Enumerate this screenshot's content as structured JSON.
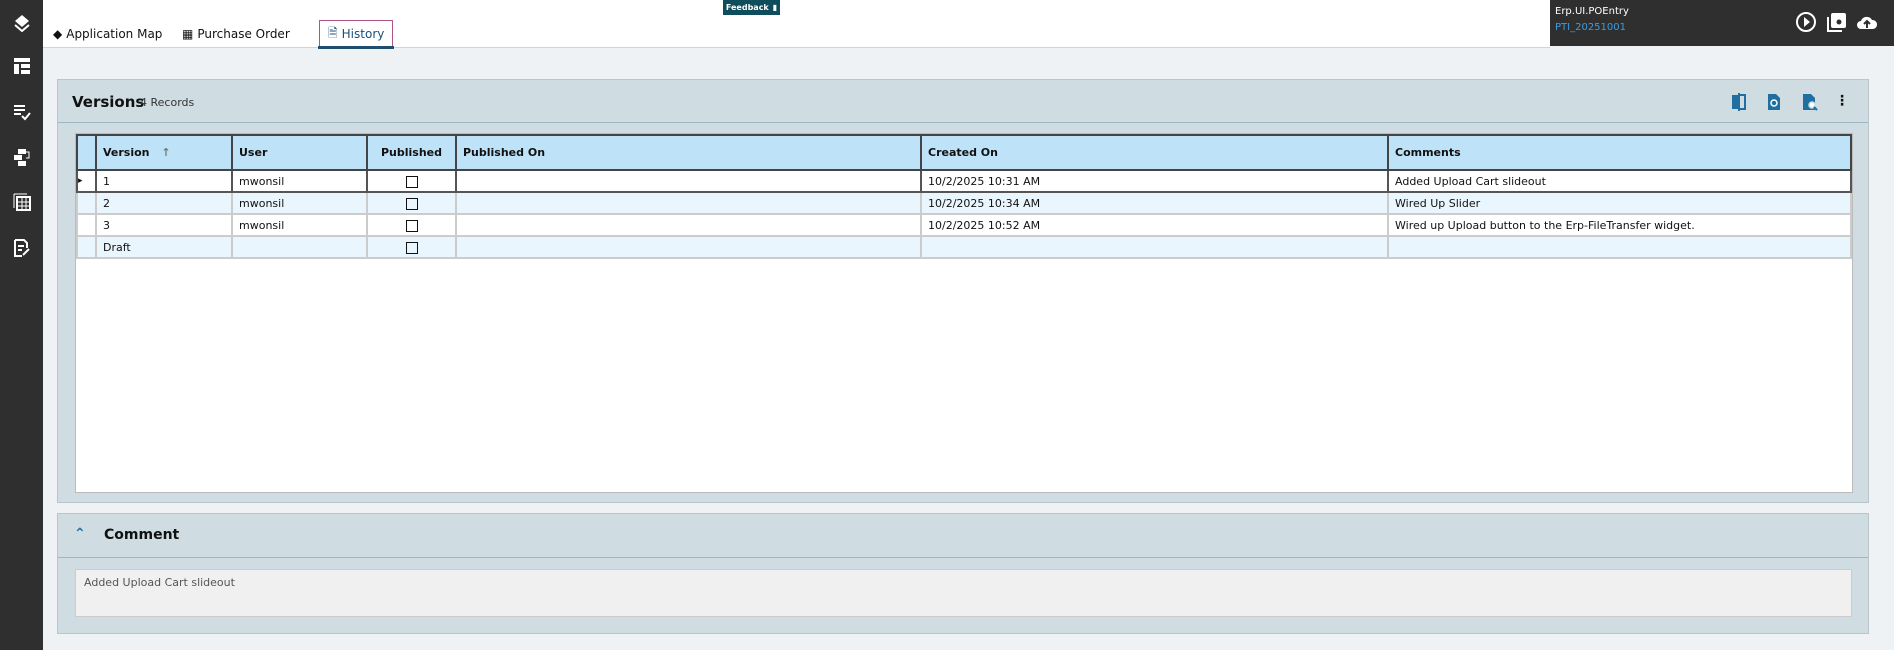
{
  "tabs": [
    {
      "label": "Application Map"
    },
    {
      "label": "Purchase Order"
    },
    {
      "label": "History"
    }
  ],
  "feedback": "Feedback",
  "app": {
    "name": "Erp.UI.POEntry",
    "version": "PTI_20251001"
  },
  "versions": {
    "title": "Versions",
    "count": "4 Records",
    "columns": [
      "Version",
      "User",
      "Published",
      "Published On",
      "Created On",
      "Comments"
    ],
    "sort_indicator": "↑",
    "rows": [
      {
        "version": "1",
        "user": "mwonsil",
        "published": false,
        "published_on": "",
        "created_on": "10/2/2025 10:31 AM",
        "comments": "Added Upload Cart slideout"
      },
      {
        "version": "2",
        "user": "mwonsil",
        "published": false,
        "published_on": "",
        "created_on": "10/2/2025 10:34 AM",
        "comments": "Wired Up Slider"
      },
      {
        "version": "3",
        "user": "mwonsil",
        "published": false,
        "published_on": "",
        "created_on": "10/2/2025 10:52 AM",
        "comments": "Wired up Upload button to the Erp-FileTransfer widget."
      },
      {
        "version": "Draft",
        "user": "",
        "published": false,
        "published_on": "",
        "created_on": "",
        "comments": ""
      }
    ]
  },
  "comment": {
    "title": "Comment",
    "value": "Added Upload Cart slideout"
  }
}
